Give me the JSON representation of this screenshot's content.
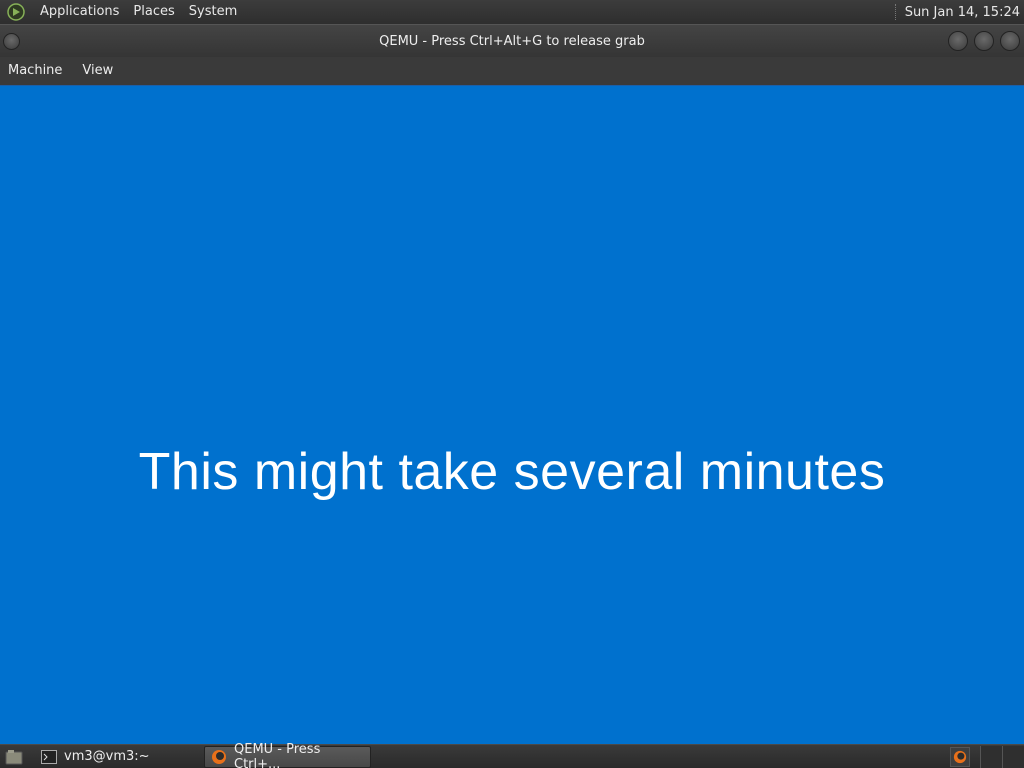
{
  "top_panel": {
    "menus": [
      "Applications",
      "Places",
      "System"
    ],
    "clock": "Sun Jan 14, 15:24",
    "icons": {
      "distro": "mint-logo-icon"
    }
  },
  "window": {
    "title": "QEMU - Press Ctrl+Alt+G to release grab",
    "menubar": [
      "Machine",
      "View"
    ]
  },
  "guest": {
    "message": "This might take several minutes",
    "background": "#0071ce"
  },
  "taskbar": {
    "tasks": [
      {
        "label": "vm3@vm3:~",
        "icon": "terminal-icon"
      },
      {
        "label": "QEMU - Press Ctrl+...",
        "icon": "qemu-icon"
      }
    ]
  }
}
